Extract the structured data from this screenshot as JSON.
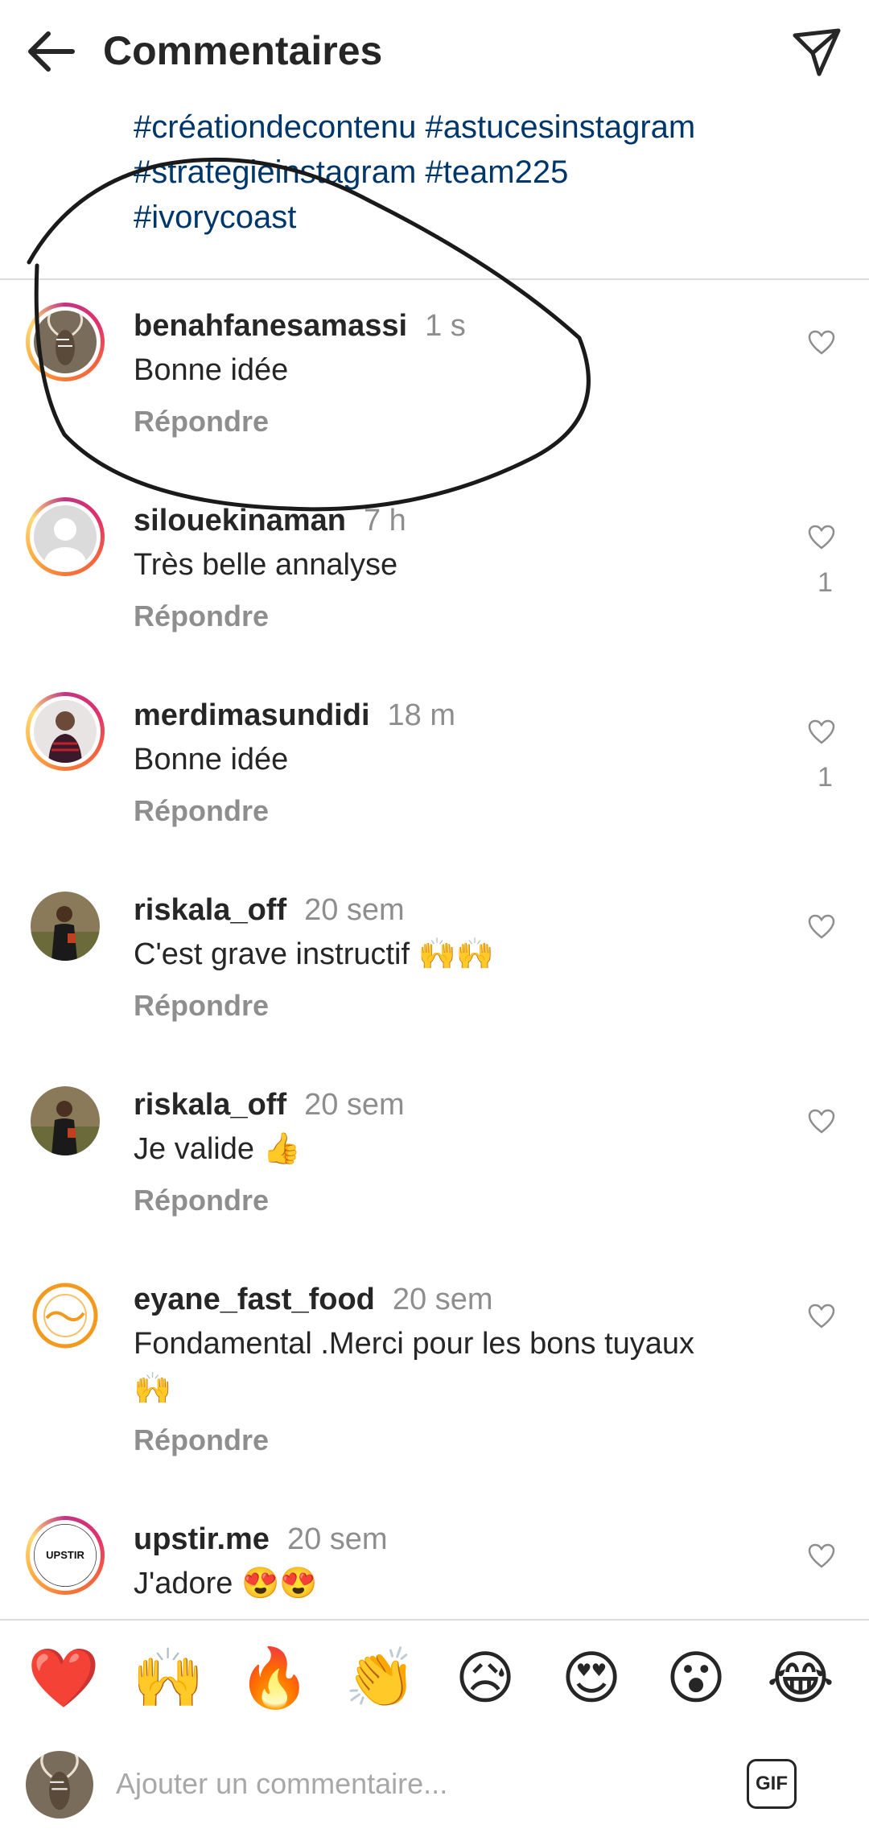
{
  "header": {
    "title": "Commentaires",
    "back_icon": "arrow-left-icon",
    "share_icon": "paper-plane-icon"
  },
  "caption": {
    "lines": [
      "#créationdecontenu #astucesinstagram",
      "#strategieinstagram #team225",
      "#ivorycoast"
    ]
  },
  "comments": [
    {
      "username": "benahfanesamassi",
      "time": "1 s",
      "text": "Bonne idée",
      "reply": "Répondre",
      "likes": ""
    },
    {
      "username": "silouekinaman",
      "time": "7 h",
      "text": "Très belle annalyse",
      "reply": "Répondre",
      "likes": "1"
    },
    {
      "username": "merdimasundidi",
      "time": "18 m",
      "text": "Bonne idée",
      "reply": "Répondre",
      "likes": "1"
    },
    {
      "username": "riskala_off",
      "time": "20 sem",
      "text": "C'est grave instructif 🙌🙌",
      "reply": "Répondre",
      "likes": ""
    },
    {
      "username": "riskala_off",
      "time": "20 sem",
      "text": "Je valide 👍",
      "reply": "Répondre",
      "likes": ""
    },
    {
      "username": "eyane_fast_food",
      "time": "20 sem",
      "text": "Fondamental .Merci pour les bons tuyaux🙌",
      "reply": "Répondre",
      "likes": ""
    },
    {
      "username": "upstir.me",
      "time": "20 sem",
      "text": "J'adore 😍😍",
      "reply": "",
      "likes": ""
    }
  ],
  "avatars": {
    "upstir_label": "UPSTIR"
  },
  "emoji_bar": [
    "❤️",
    "🙌",
    "🔥",
    "👏",
    "😥",
    "😍",
    "😮",
    "😂"
  ],
  "composer": {
    "placeholder": "Ajouter un commentaire...",
    "gif_label": "GIF"
  },
  "colors": {
    "hashtag": "#00376b",
    "secondary_text": "#8e8e8e",
    "primary_text": "#262626",
    "divider": "#dbdbdb"
  }
}
